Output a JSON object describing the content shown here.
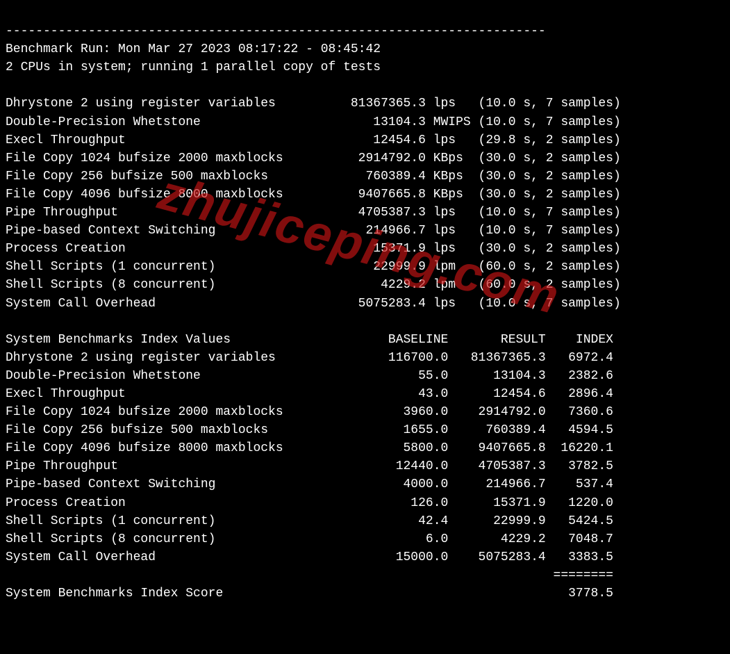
{
  "separator": "------------------------------------------------------------------------",
  "benchmark_run_label": "Benchmark Run:",
  "benchmark_run_time": "Mon Mar 27 2023 08:17:22 - 08:45:42",
  "cpu_info": "2 CPUs in system; running 1 parallel copy of tests",
  "watermark": "zhujiceping.com",
  "tests": [
    {
      "name": "Dhrystone 2 using register variables",
      "value": "81367365.3",
      "unit": "lps",
      "time": "10.0",
      "samples": "7"
    },
    {
      "name": "Double-Precision Whetstone",
      "value": "13104.3",
      "unit": "MWIPS",
      "time": "10.0",
      "samples": "7"
    },
    {
      "name": "Execl Throughput",
      "value": "12454.6",
      "unit": "lps",
      "time": "29.8",
      "samples": "2"
    },
    {
      "name": "File Copy 1024 bufsize 2000 maxblocks",
      "value": "2914792.0",
      "unit": "KBps",
      "time": "30.0",
      "samples": "2"
    },
    {
      "name": "File Copy 256 bufsize 500 maxblocks",
      "value": "760389.4",
      "unit": "KBps",
      "time": "30.0",
      "samples": "2"
    },
    {
      "name": "File Copy 4096 bufsize 8000 maxblocks",
      "value": "9407665.8",
      "unit": "KBps",
      "time": "30.0",
      "samples": "2"
    },
    {
      "name": "Pipe Throughput",
      "value": "4705387.3",
      "unit": "lps",
      "time": "10.0",
      "samples": "7"
    },
    {
      "name": "Pipe-based Context Switching",
      "value": "214966.7",
      "unit": "lps",
      "time": "10.0",
      "samples": "7"
    },
    {
      "name": "Process Creation",
      "value": "15371.9",
      "unit": "lps",
      "time": "30.0",
      "samples": "2"
    },
    {
      "name": "Shell Scripts (1 concurrent)",
      "value": "22999.9",
      "unit": "lpm",
      "time": "60.0",
      "samples": "2"
    },
    {
      "name": "Shell Scripts (8 concurrent)",
      "value": "4229.2",
      "unit": "lpm",
      "time": "60.0",
      "samples": "2"
    },
    {
      "name": "System Call Overhead",
      "value": "5075283.4",
      "unit": "lps",
      "time": "10.0",
      "samples": "7"
    }
  ],
  "index_header": {
    "label": "System Benchmarks Index Values",
    "baseline": "BASELINE",
    "result": "RESULT",
    "index": "INDEX"
  },
  "index_values": [
    {
      "name": "Dhrystone 2 using register variables",
      "baseline": "116700.0",
      "result": "81367365.3",
      "index": "6972.4"
    },
    {
      "name": "Double-Precision Whetstone",
      "baseline": "55.0",
      "result": "13104.3",
      "index": "2382.6"
    },
    {
      "name": "Execl Throughput",
      "baseline": "43.0",
      "result": "12454.6",
      "index": "2896.4"
    },
    {
      "name": "File Copy 1024 bufsize 2000 maxblocks",
      "baseline": "3960.0",
      "result": "2914792.0",
      "index": "7360.6"
    },
    {
      "name": "File Copy 256 bufsize 500 maxblocks",
      "baseline": "1655.0",
      "result": "760389.4",
      "index": "4594.5"
    },
    {
      "name": "File Copy 4096 bufsize 8000 maxblocks",
      "baseline": "5800.0",
      "result": "9407665.8",
      "index": "16220.1"
    },
    {
      "name": "Pipe Throughput",
      "baseline": "12440.0",
      "result": "4705387.3",
      "index": "3782.5"
    },
    {
      "name": "Pipe-based Context Switching",
      "baseline": "4000.0",
      "result": "214966.7",
      "index": "537.4"
    },
    {
      "name": "Process Creation",
      "baseline": "126.0",
      "result": "15371.9",
      "index": "1220.0"
    },
    {
      "name": "Shell Scripts (1 concurrent)",
      "baseline": "42.4",
      "result": "22999.9",
      "index": "5424.5"
    },
    {
      "name": "Shell Scripts (8 concurrent)",
      "baseline": "6.0",
      "result": "4229.2",
      "index": "7048.7"
    },
    {
      "name": "System Call Overhead",
      "baseline": "15000.0",
      "result": "5075283.4",
      "index": "3383.5"
    }
  ],
  "score_separator": "========",
  "score_line": {
    "label": "System Benchmarks Index Score",
    "value": "3778.5"
  }
}
